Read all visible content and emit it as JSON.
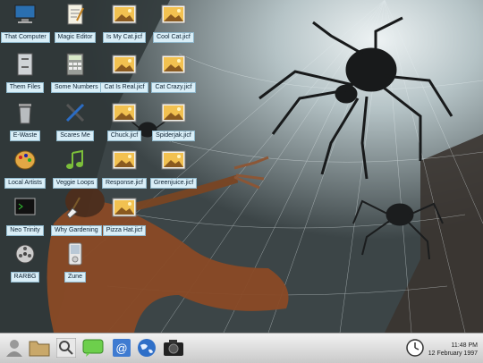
{
  "desktop_icons": [
    {
      "label": "That Computer",
      "icon": "monitor-icon"
    },
    {
      "label": "Magic Editor",
      "icon": "editor-icon"
    },
    {
      "label": "Is My Cat.jicf",
      "icon": "image-file-icon"
    },
    {
      "label": "Cool Cat.jicf",
      "icon": "image-file-icon"
    },
    {
      "label": "Them Files",
      "icon": "file-cabinet-icon"
    },
    {
      "label": "Some Numbers",
      "icon": "calculator-icon"
    },
    {
      "label": "Cat Is Real.jicf",
      "icon": "image-file-icon"
    },
    {
      "label": "Cat Crazy.jicf",
      "icon": "image-file-icon"
    },
    {
      "label": "E-Waste",
      "icon": "trash-icon"
    },
    {
      "label": "Scares Me",
      "icon": "tools-icon"
    },
    {
      "label": "Chuck.jicf",
      "icon": "image-file-icon"
    },
    {
      "label": "Spiderjak.jicf",
      "icon": "image-file-icon"
    },
    {
      "label": "Local Artists",
      "icon": "palette-icon"
    },
    {
      "label": "Veggie Loops",
      "icon": "music-icon"
    },
    {
      "label": "Response.jicf",
      "icon": "image-file-icon"
    },
    {
      "label": "Greenjuice.jicf",
      "icon": "image-file-icon"
    },
    {
      "label": "Neo Trinity",
      "icon": "terminal-icon"
    },
    {
      "label": "Why Gardening",
      "icon": "shovel-icon"
    },
    {
      "label": "Pizza Hat.jicf",
      "icon": "image-file-icon"
    },
    {
      "label": "RARBG",
      "icon": "film-reel-icon"
    },
    {
      "label": "Zune",
      "icon": "media-player-icon"
    }
  ],
  "taskbar": {
    "items": [
      {
        "name": "user-icon"
      },
      {
        "name": "folder-icon"
      },
      {
        "name": "search-icon"
      },
      {
        "name": "chat-icon"
      },
      {
        "name": "email-icon"
      },
      {
        "name": "globe-icon"
      },
      {
        "name": "camera-icon"
      }
    ],
    "clock": {
      "time": "11:48 PM",
      "date": "12 February 1997",
      "icon": "clock-icon"
    }
  },
  "colors": {
    "label_bg": "#d9eef7",
    "taskbar_bg": "#dcdcdc",
    "wallpaper_dark": "#3d4848"
  }
}
